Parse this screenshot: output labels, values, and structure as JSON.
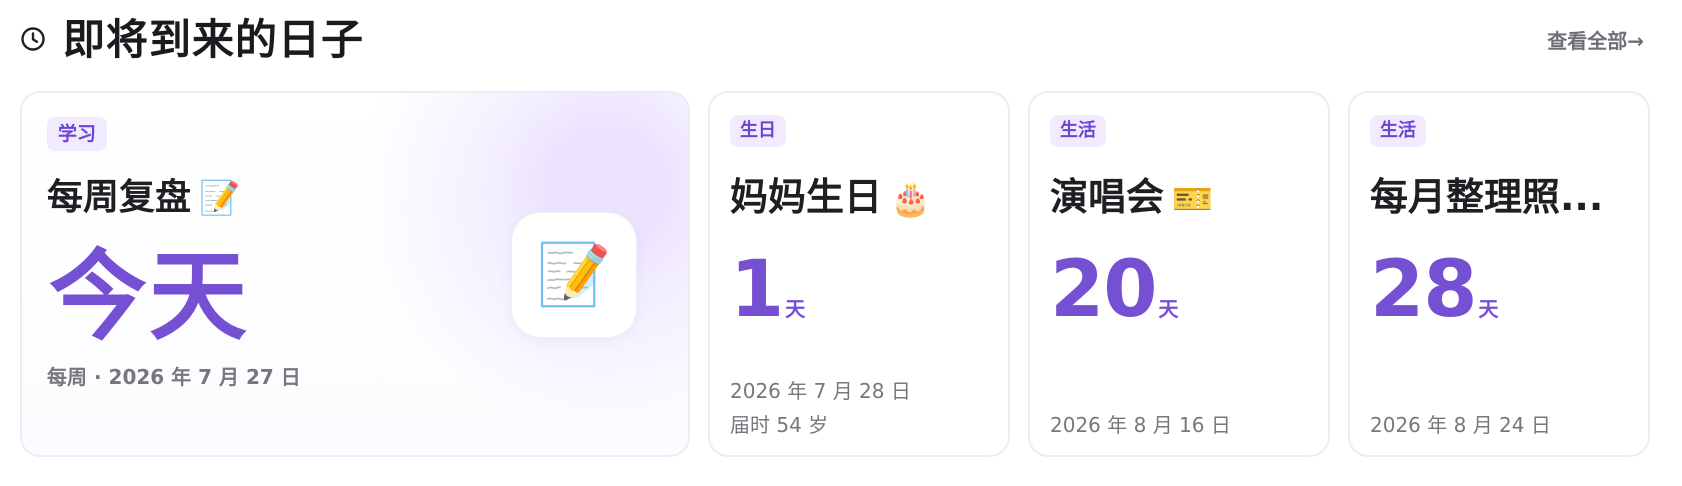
{
  "header": {
    "icon": "clock-icon",
    "title": "即将到来的日子",
    "view_all": "查看全部→"
  },
  "cards": [
    {
      "tag": "学习",
      "title": "每周复盘",
      "emoji": "📝",
      "status": "今天",
      "meta": "每周 · 2026 年 7 月 27 日",
      "icon": "memo-icon"
    },
    {
      "tag": "生日",
      "title": "妈妈生日",
      "emoji": "🎂",
      "days": "1",
      "unit": "天",
      "date": "2026 年 7 月 28 日",
      "extra": "届时 54 岁"
    },
    {
      "tag": "生活",
      "title": "演唱会",
      "emoji": "🎫",
      "days": "20",
      "unit": "天",
      "date": "2026 年 8 月 16 日"
    },
    {
      "tag": "生活",
      "title": "每月整理照...",
      "days": "28",
      "unit": "天",
      "date": "2026 年 8 月 24 日"
    }
  ],
  "colors": {
    "accent": "#7650d2",
    "tag_background": "#f0ebff",
    "card_border": "#ececf2",
    "muted_text": "#77777e"
  }
}
